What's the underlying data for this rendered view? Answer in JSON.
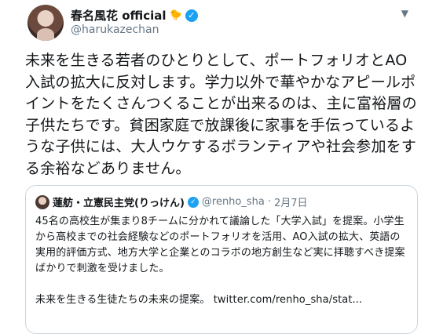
{
  "tweet": {
    "display_name": "春名風花 official",
    "name_emoji": "🐤",
    "handle": "@harukazechan",
    "text": "未来を生きる若者のひとりとして、ポートフォリオとAO入試の拡大に反対します。学力以外で華やかなアピールポイントをたくさんつくることが出来るのは、主に富裕層の子供たちです。貧困家庭で放課後に家事を手伝っているような子供には、大人ウケするボランティアや社会参加をする余裕などありません。"
  },
  "quoted": {
    "display_name": "蓮舫・立憲民主党(りっけん)",
    "handle": "@renho_sha",
    "separator": "·",
    "date": "2月7日",
    "body": "45名の高校生が集まり8チームに分かれて議論した「大学入試」を提案。小学生から高校までの社会経験などのポートフォリオを活用、AO入試の拡大、英語の実用的評価方式、地方大学と企業とのコラボの地方創生など実に拝聴すべき提案ばかりで刺激を受けました。",
    "footer": "未来を生きる生徒たちの未来の提案。",
    "link": "twitter.com/renho_sha/stat..."
  },
  "colors": {
    "verified": "#1da1f2",
    "secondary_text": "#657786",
    "border": "#ccd6dd"
  },
  "icons": {
    "verified": "verified-badge-icon",
    "menu": "chevron-down-icon"
  }
}
